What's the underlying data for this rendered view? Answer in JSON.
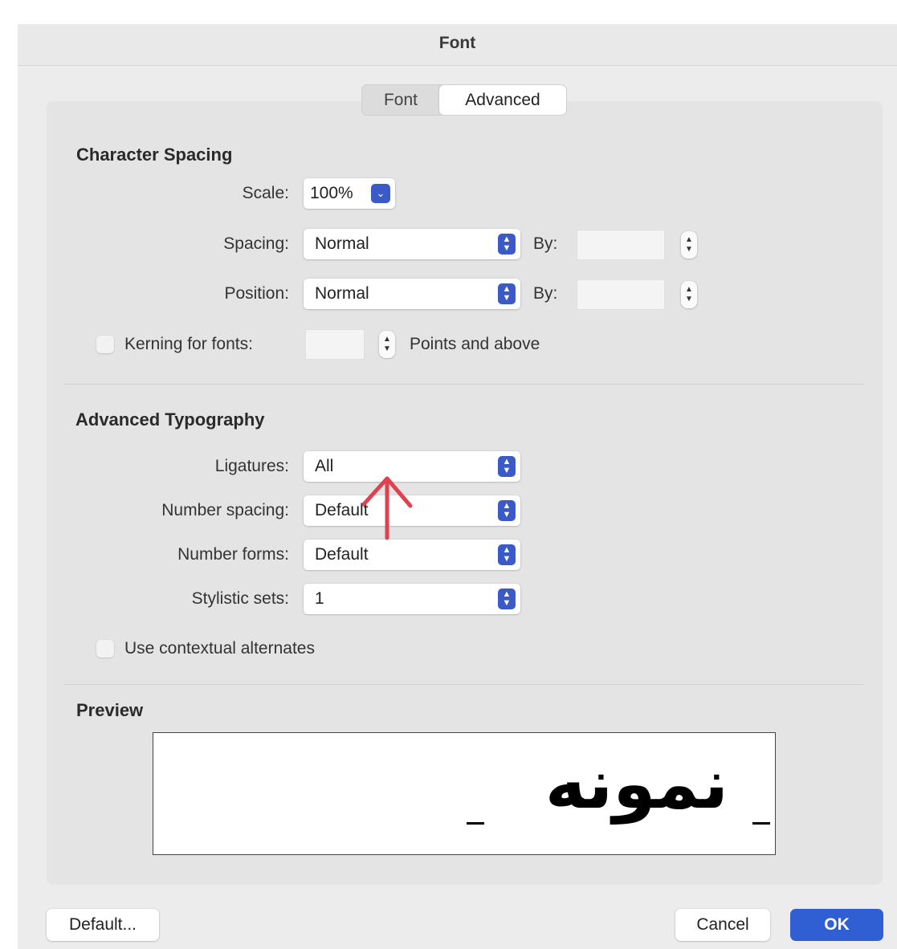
{
  "window": {
    "title": "Font"
  },
  "tabs": [
    {
      "label": "Font",
      "selected": false
    },
    {
      "label": "Advanced",
      "selected": true
    }
  ],
  "character_spacing": {
    "heading": "Character Spacing",
    "scale": {
      "label": "Scale:",
      "value": "100%"
    },
    "spacing": {
      "label": "Spacing:",
      "value": "Normal",
      "by_label": "By:"
    },
    "position": {
      "label": "Position:",
      "value": "Normal",
      "by_label": "By:"
    },
    "kerning": {
      "label": "Kerning for fonts:",
      "suffix": "Points and above",
      "checked": false
    }
  },
  "advanced_typography": {
    "heading": "Advanced Typography",
    "ligatures": {
      "label": "Ligatures:",
      "value": "All"
    },
    "number_spacing": {
      "label": "Number spacing:",
      "value": "Default"
    },
    "number_forms": {
      "label": "Number forms:",
      "value": "Default"
    },
    "stylistic_sets": {
      "label": "Stylistic sets:",
      "value": "1"
    },
    "contextual_alternates": {
      "label": "Use contextual alternates",
      "checked": false
    }
  },
  "preview": {
    "heading": "Preview",
    "sample": "نمونه"
  },
  "buttons": {
    "default": "Default...",
    "cancel": "Cancel",
    "ok": "OK"
  },
  "colors": {
    "accent": "#2f5fd3",
    "annotation_arrow": "#e0414f"
  }
}
